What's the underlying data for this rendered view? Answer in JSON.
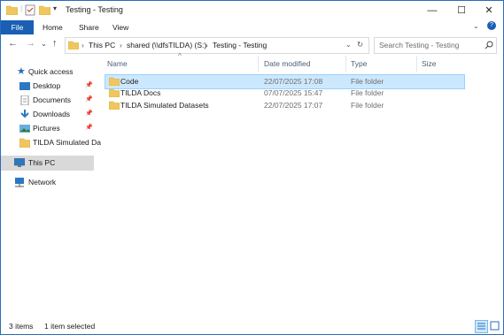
{
  "window": {
    "title": "Testing - Testing"
  },
  "window_controls": {
    "minimize": "—",
    "maximize": "☐",
    "close": "✕"
  },
  "ribbon": {
    "tabs": [
      "File",
      "Home",
      "Share",
      "View"
    ]
  },
  "address": {
    "segments": [
      "This PC",
      "shared (\\\\dfsTILDA) (S:)",
      "Testing - Testing"
    ],
    "separator": "›"
  },
  "search": {
    "placeholder": "Search Testing - Testing"
  },
  "sidebar": {
    "quick_access": "Quick access",
    "items": [
      {
        "label": "Desktop",
        "icon": "desktop-icon"
      },
      {
        "label": "Documents",
        "icon": "documents-icon"
      },
      {
        "label": "Downloads",
        "icon": "downloads-icon"
      },
      {
        "label": "Pictures",
        "icon": "pictures-icon"
      },
      {
        "label": "TILDA Simulated Da",
        "icon": "folder-icon"
      }
    ],
    "this_pc": "This PC",
    "network": "Network"
  },
  "columns": {
    "name": "Name",
    "date": "Date modified",
    "type": "Type",
    "size": "Size"
  },
  "files": [
    {
      "name": "Code",
      "date": "22/07/2025 17:08",
      "type": "File folder",
      "selected": true
    },
    {
      "name": "TILDA Docs",
      "date": "07/07/2025 15:47",
      "type": "File folder",
      "selected": false
    },
    {
      "name": "TILDA Simulated Datasets",
      "date": "22/07/2025 17:07",
      "type": "File folder",
      "selected": false
    }
  ],
  "status": {
    "item_count": "3 items",
    "selection": "1 item selected"
  },
  "colors": {
    "accent": "#1a5fb4",
    "selection": "#cce8ff",
    "folder": "#f0c75e"
  }
}
